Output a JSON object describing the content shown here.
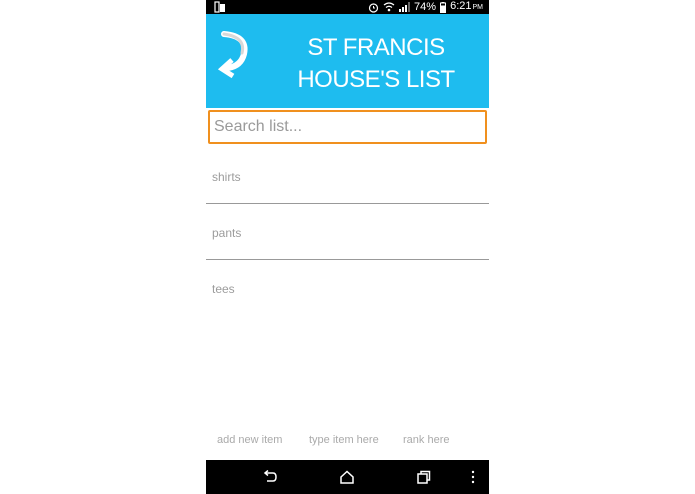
{
  "status_bar": {
    "battery_percent": "74%",
    "time": "6:21",
    "ampm": "PM"
  },
  "header": {
    "title_line1": "ST FRANCIS",
    "title_line2": "HOUSE'S LIST",
    "color": "#1ebcef"
  },
  "search": {
    "placeholder": "Search list..."
  },
  "list": {
    "items": [
      {
        "label": "shirts"
      },
      {
        "label": "pants"
      },
      {
        "label": "tees"
      }
    ]
  },
  "footer": {
    "add_new_item": "add new item",
    "type_item_here": "type item here",
    "rank_here": "rank here"
  },
  "nav": {
    "icons": [
      "back-icon",
      "home-icon",
      "recents-icon",
      "overflow-menu-icon"
    ]
  }
}
